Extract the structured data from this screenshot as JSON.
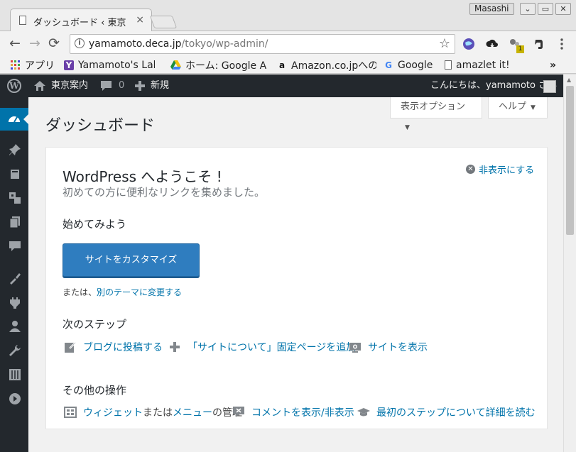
{
  "browser": {
    "tab_title": "ダッシュボード ‹ 東京",
    "tab_close": "×",
    "user": "Masashi",
    "window_buttons": [
      "⌄",
      "▭",
      "✕"
    ],
    "nav": {
      "back": "←",
      "forward": "→",
      "reload": "⟳"
    },
    "url_host": "yamamoto.deca.jp",
    "url_path": "/tokyo/wp-admin/",
    "info_glyph": "i",
    "star_glyph": "☆",
    "ext_badge": "1",
    "bookmarks": [
      {
        "label": "アプリ",
        "icon": "apps-grid-icon"
      },
      {
        "label": "Yamamoto's Lab",
        "icon": "y-logo-icon"
      },
      {
        "label": "ホーム: Google Ap",
        "icon": "drive-icon"
      },
      {
        "label": "Amazon.co.jpへの",
        "icon": "amazon-icon"
      },
      {
        "label": "Google",
        "icon": "google-icon"
      },
      {
        "label": "amazlet it!",
        "icon": "page-icon"
      }
    ],
    "bookmarks_more": "»"
  },
  "adminbar": {
    "site_name": "東京案内",
    "comments_count": "0",
    "new_label": "新規",
    "greeting": "こんにちは、yamamoto さん"
  },
  "screen_tabs": {
    "options": "表示オプション",
    "help": "ヘルプ",
    "arrow": "▼"
  },
  "page": {
    "title": "ダッシュボード"
  },
  "welcome": {
    "heading": "WordPress へようこそ !",
    "subheading": "初めての方に便利なリンクを集めました。",
    "dismiss": "非表示にする",
    "get_started": "始めてみよう",
    "customize_button": "サイトをカスタマイズ",
    "alt_prefix": "または、",
    "alt_link": "別のテーマに変更する",
    "next_steps": "次のステップ",
    "next": [
      {
        "label": "ブログに投稿する",
        "icon": "edit-page-icon"
      },
      {
        "label": "「サイトについて」固定ページを追加",
        "icon": "plus-icon"
      },
      {
        "label": "サイトを表示",
        "icon": "view-site-icon"
      }
    ],
    "more_actions": "その他の操作",
    "more": {
      "widgets_link": "ウィジェット",
      "widgets_mid": "または",
      "menus_link": "メニュー",
      "menus_suffix": "の管理",
      "comments": "コメントを表示/非表示",
      "learn": "最初のステップについて詳細を読む"
    }
  }
}
